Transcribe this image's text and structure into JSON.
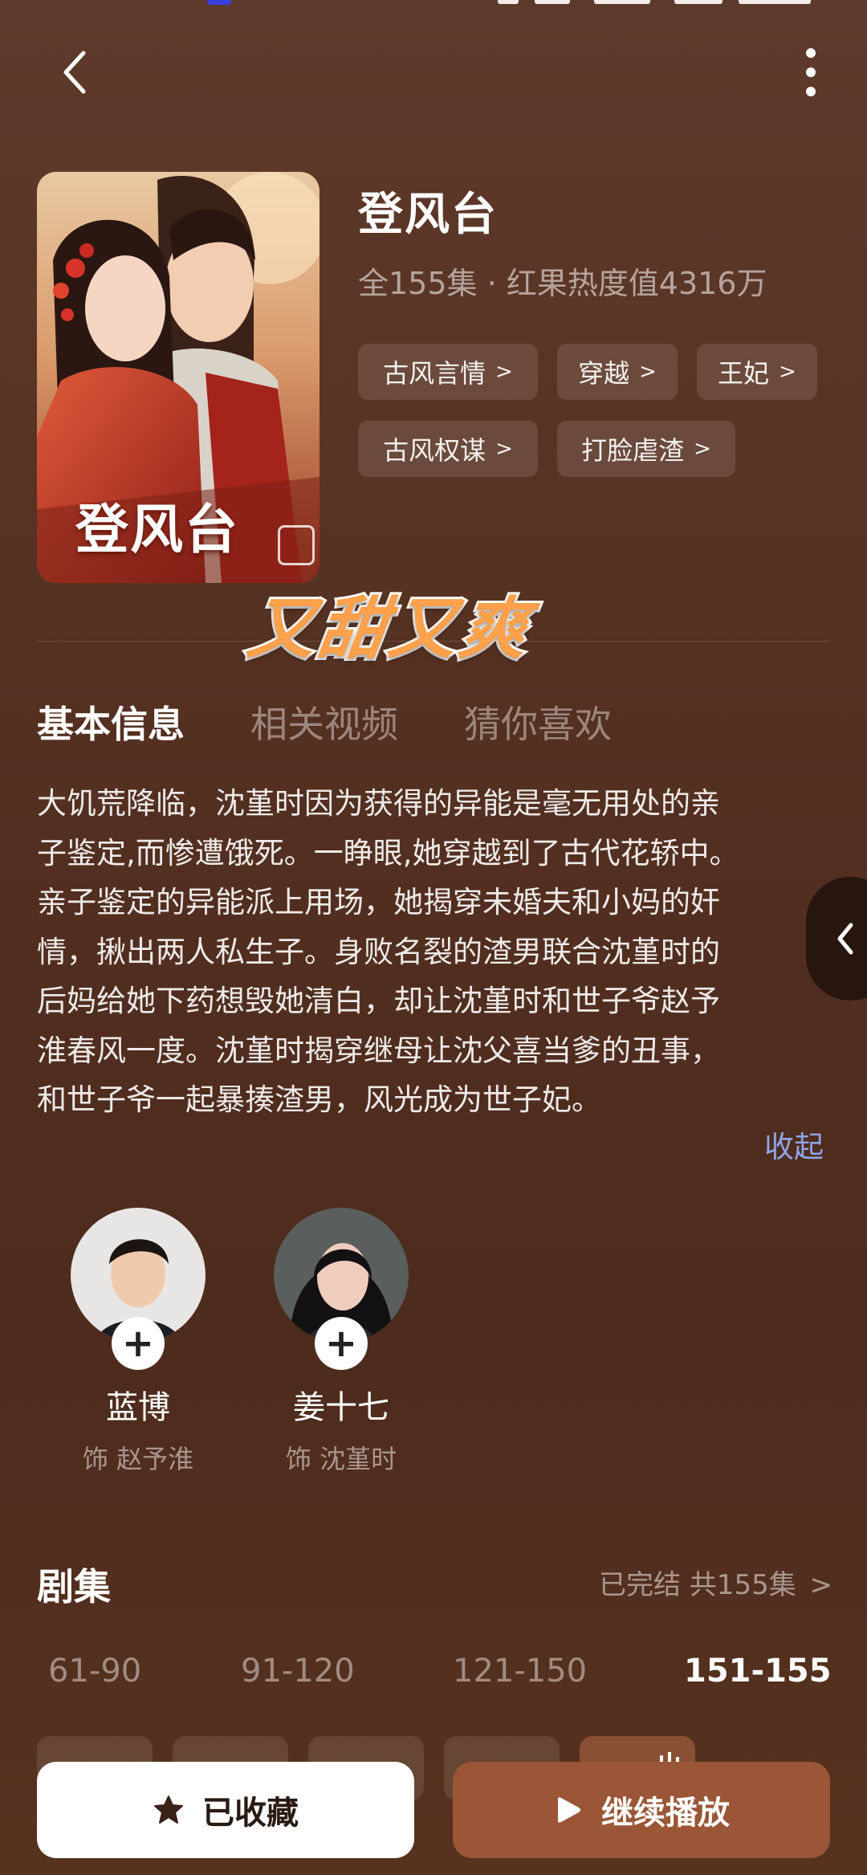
{
  "header": {
    "back_icon": "chevron-left-icon",
    "more_icon": "more-vertical-icon"
  },
  "drama": {
    "title": "登风台",
    "meta": "全155集 · 红果热度值4316万",
    "poster_title": "登风台",
    "tags": [
      {
        "label": "古风言情"
      },
      {
        "label": "穿越"
      },
      {
        "label": "王妃"
      },
      {
        "label": "古风权谋"
      },
      {
        "label": "打脸虐渣"
      }
    ],
    "sticker_text": "又甜又爽"
  },
  "tabs": [
    {
      "label": "基本信息",
      "active": true
    },
    {
      "label": "相关视频",
      "active": false
    },
    {
      "label": "猜你喜欢",
      "active": false
    }
  ],
  "description": {
    "lines": [
      "大饥荒降临，沈堇时因为获得的异能是毫无用处的亲",
      "子鉴定,而惨遭饿死。一睁眼,她穿越到了古代花轿中。",
      "亲子鉴定的异能派上用场，她揭穿未婚夫和小妈的奸",
      "情，揪出两人私生子。身败名裂的渣男联合沈堇时的",
      "后妈给她下药想毁她清白，却让沈堇时和世子爷赵予",
      "淮春风一度。沈堇时揭穿继母让沈父喜当爹的丑事，",
      "和世子爷一起暴揍渣男，风光成为世子妃。"
    ],
    "collapse_label": "收起"
  },
  "cast": [
    {
      "name": "蓝博",
      "role": "饰 赵予淮"
    },
    {
      "name": "姜十七",
      "role": "饰 沈堇时"
    }
  ],
  "episodes": {
    "title": "剧集",
    "status": "已完结 共155集",
    "ranges": [
      {
        "label": "61-90",
        "active": false
      },
      {
        "label": "91-120",
        "active": false
      },
      {
        "label": "121-150",
        "active": false
      },
      {
        "label": "151-155",
        "active": true
      }
    ]
  },
  "actions": {
    "favorite_label": "已收藏",
    "play_label": "继续播放"
  },
  "colors": {
    "accent_link": "#8fa6e8",
    "play_button": "#9a5636",
    "sticker": "#ffa04a"
  }
}
